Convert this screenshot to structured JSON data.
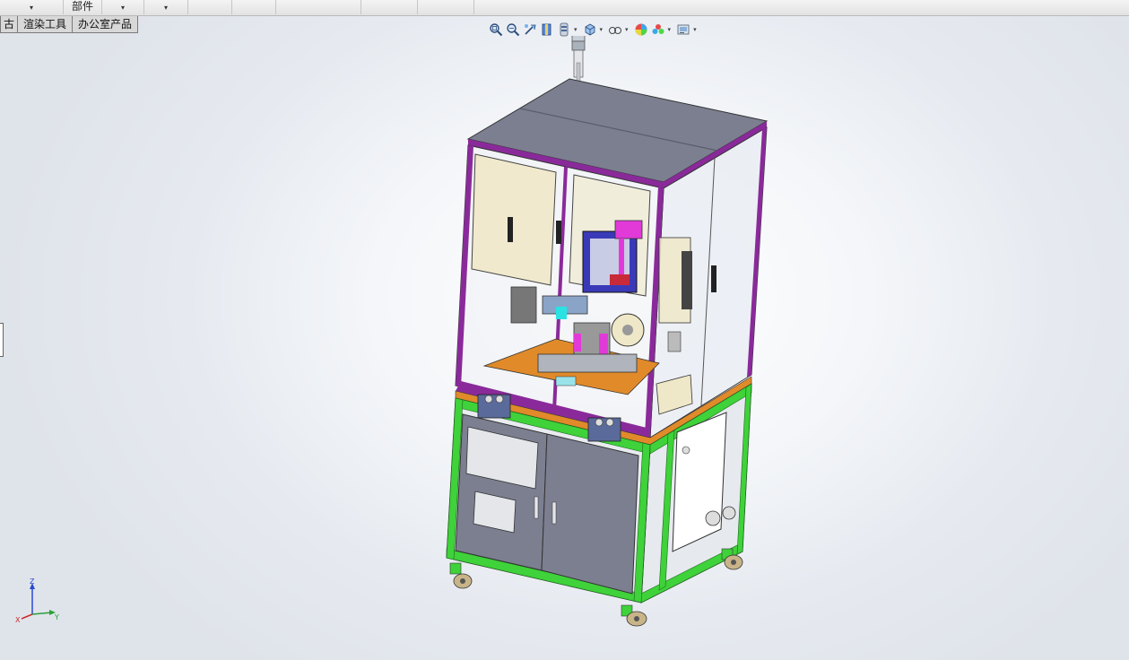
{
  "ribbon": {
    "part_label": "部件",
    "dropdown_glyph": "▾"
  },
  "tabs": [
    {
      "label": "古"
    },
    {
      "label": "渲染工具"
    },
    {
      "label": "办公室产品"
    }
  ],
  "heads_up_toolbar": {
    "icons": [
      "zoom-to-fit-icon",
      "zoom-to-area-icon",
      "previous-view-icon",
      "section-view-icon",
      "dynamic-annotation-icon",
      "view-orientation-icon",
      "display-style-icon",
      "hide-show-items-icon",
      "edit-appearance-icon",
      "apply-scene-icon",
      "view-settings-icon"
    ]
  },
  "triad": {
    "x_label": "X",
    "y_label": "Y",
    "z_label": "Z",
    "x_color": "#d22a2a",
    "y_color": "#2aa03a",
    "z_color": "#2a4ad2"
  },
  "colors": {
    "frame_green": "#3fd23a",
    "frame_purple": "#8a2a9a",
    "panel_gray": "#7c7f90",
    "accent_orange": "#e08a2a",
    "accent_magenta": "#e23ad8"
  }
}
